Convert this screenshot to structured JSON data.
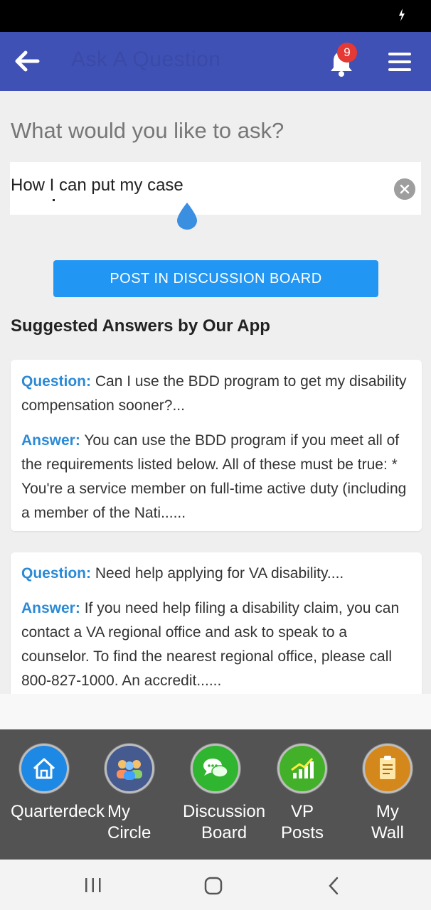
{
  "app_bar": {
    "title": "Ask A Question",
    "notification_count": "9",
    "colors": {
      "background": "#3f51b5",
      "badge": "#e53935"
    }
  },
  "prompt": "What would you like to ask?",
  "question_input": {
    "value": "How I can put my case"
  },
  "post_button_label": "POST IN DISCUSSION BOARD",
  "suggested_title": "Suggested Answers by Our App",
  "suggestions": [
    {
      "question_label": "Question:",
      "question": "Can I use the BDD program to get my disability compensation sooner?...",
      "answer_label": "Answer:",
      "answer": "You can use the BDD program if you meet all of the requirements listed below. All of these must be true: * You're a service member on full-time active duty (including a member of the Nati......"
    },
    {
      "question_label": "Question:",
      "question": "Need help applying for VA disability....",
      "answer_label": "Answer:",
      "answer": "If you need help filing a disability claim, you can contact a VA regional office and ask to speak to a counselor. To find the nearest regional office, please call 800-827-1000. An accredit......"
    }
  ],
  "bottom_nav": [
    {
      "label": "Quarterdeck",
      "icon": "home-icon",
      "color": "#1e88e5"
    },
    {
      "label": "My\nCircle",
      "icon": "people-icon",
      "color": "#455a8f"
    },
    {
      "label": "Discussion\nBoard",
      "icon": "chat-icon",
      "color": "#2fb52f"
    },
    {
      "label": "VP\nPosts",
      "icon": "growth-chart-icon",
      "color": "#43b02a"
    },
    {
      "label": "My\nWall",
      "icon": "notepad-icon",
      "color": "#d4881b"
    }
  ],
  "system_nav": [
    "recent-apps-icon",
    "home-button-icon",
    "back-button-icon"
  ]
}
